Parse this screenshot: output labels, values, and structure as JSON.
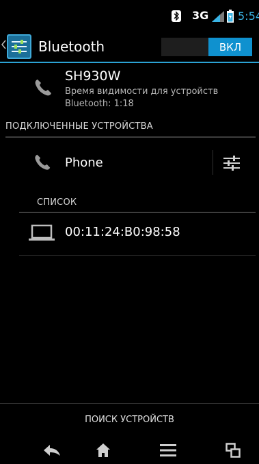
{
  "status_bar": {
    "network": "3G",
    "time": "5:54",
    "icons": [
      "bluetooth-icon",
      "signal-icon",
      "battery-icon"
    ]
  },
  "action_bar": {
    "title": "Bluetooth",
    "toggle_label": "ВКЛ",
    "accent": "#2ba2d4"
  },
  "this_device": {
    "name": "SH930W",
    "visibility_line1": "Время видимости для устройств",
    "visibility_line2": "Bluetooth: 1:18"
  },
  "paired": {
    "header": "ПОДКЛЮЧЕННЫЕ УСТРОЙСТВА",
    "devices": [
      {
        "name": "Phone"
      }
    ]
  },
  "available": {
    "header": "СПИСОК",
    "devices": [
      {
        "name": "00:11:24:B0:98:58"
      }
    ]
  },
  "footer": {
    "search_label": "ПОИСК УСТРОЙСТВ"
  },
  "nav": [
    "back-icon",
    "home-icon",
    "menu-icon",
    "recents-icon"
  ]
}
